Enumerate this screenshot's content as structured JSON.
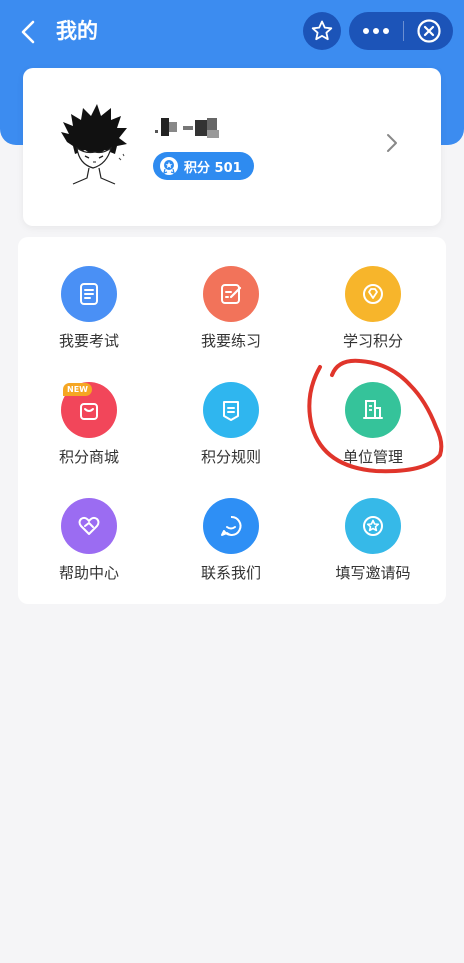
{
  "header": {
    "title": "我的",
    "icons": [
      "back-arrow-icon",
      "star-icon",
      "more-icon",
      "close-icon"
    ]
  },
  "profile": {
    "points_label": "积分 501",
    "icons": [
      "avatar",
      "medal-icon",
      "chevron-right-icon"
    ]
  },
  "menu": {
    "new_tag": "NEW",
    "items": [
      {
        "label": "我要考试",
        "icon": "exam-icon",
        "color": "#4a90f5"
      },
      {
        "label": "我要练习",
        "icon": "practice-icon",
        "color": "#f2735a"
      },
      {
        "label": "学习积分",
        "icon": "points-icon",
        "color": "#f7b52b"
      },
      {
        "label": "积分商城",
        "icon": "shop-bag-icon",
        "color": "#f2465a"
      },
      {
        "label": "积分规则",
        "icon": "rules-icon",
        "color": "#2fb6ef"
      },
      {
        "label": "单位管理",
        "icon": "building-icon",
        "color": "#35c39a"
      },
      {
        "label": "帮助中心",
        "icon": "help-heart-icon",
        "color": "#9b6cf2"
      },
      {
        "label": "联系我们",
        "icon": "chat-icon",
        "color": "#2e8ff5"
      },
      {
        "label": "填写邀请码",
        "icon": "invite-icon",
        "color": "#36b9e8"
      }
    ]
  },
  "colors": {
    "header_blue": "#3c8cf0",
    "capsule_blue": "#1c54b8",
    "annotation_red": "#e0352b"
  }
}
